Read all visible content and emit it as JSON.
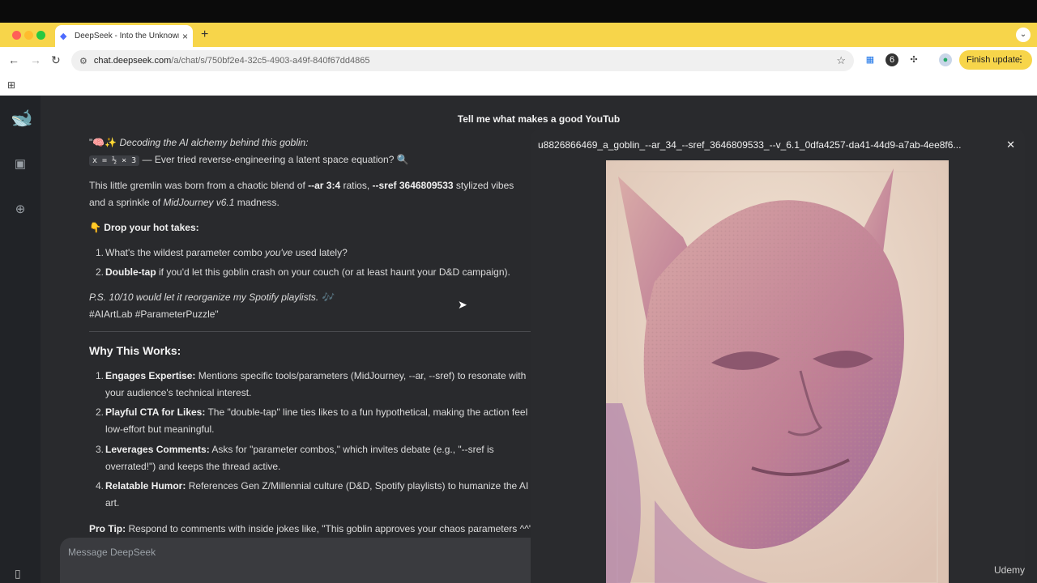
{
  "browser": {
    "tab_title": "DeepSeek - Into the Unknown",
    "url_host": "chat.deepseek.com",
    "url_path": "/a/chat/s/750bf2e4-32c5-4903-a49f-840f67dd4865",
    "finish_update_label": "Finish update",
    "ext_badge": "6"
  },
  "app": {
    "chat_title": "Tell me what makes a good YouTub",
    "composer_placeholder": "Message DeepSeek"
  },
  "message": {
    "intro_emoji": "\"🧠✨",
    "intro": "Decoding the AI alchemy behind this goblin:",
    "equation": "x = ½ × 3",
    "equation_follow": "— Ever tried reverse-engineering a latent space equation? 🔍",
    "p1_a": "This little gremlin was born from a chaotic blend of ",
    "p1_b": "--ar 3:4",
    "p1_c": " ratios, ",
    "p1_d": "--sref 3646809533",
    "p1_e": " stylized vibes",
    "p1_f": "and a sprinkle of ",
    "p1_g": "MidJourney v6.1",
    "p1_h": " madness.",
    "drop_heading": "👇 Drop your hot takes:",
    "q1_a": "What's the wildest parameter combo ",
    "q1_b": "you've",
    "q1_c": " used lately?",
    "q2_a": "Double-tap",
    "q2_b": " if you'd let this goblin crash on your couch (or at least haunt your D&D campaign).",
    "ps": "P.S. 10/10 would let it reorganize my Spotify playlists. 🎶",
    "tags": "#AIArtLab #ParameterPuzzle\"",
    "why_heading": "Why This Works:",
    "w1_a": "Engages Expertise:",
    "w1_b": " Mentions specific tools/parameters (MidJourney, --ar, --sref) to resonate with",
    "w1_c": "your audience's technical interest.",
    "w2_a": "Playful CTA for Likes:",
    "w2_b": " The \"double-tap\" line ties likes to a fun hypothetical, making the action feel",
    "w2_c": "low-effort but meaningful.",
    "w3_a": "Leverages Comments:",
    "w3_b": " Asks for \"parameter combos,\" which invites debate (e.g., \"--sref is",
    "w3_c": "overrated!\") and keeps the thread active.",
    "w4_a": "Relatable Humor:",
    "w4_b": " References Gen Z/Millennial culture (D&D, Spotify playlists) to humanize the AI",
    "w4_c": "art.",
    "tip_a": "Pro Tip:",
    "tip_b": " Respond to comments with inside jokes like, \"This goblin approves your chaos parameters ^^\""
  },
  "viewer": {
    "filename": "u8826866469_a_goblin_--ar_34_--sref_3646809533_--v_6.1_0dfa4257-da41-44d9-a7ab-4ee8f6..."
  },
  "watermark": "Udemy",
  "colors": {
    "accent": "#4d6bfe",
    "tabstrip": "#f7d54a",
    "app_bg": "#292a2d"
  }
}
